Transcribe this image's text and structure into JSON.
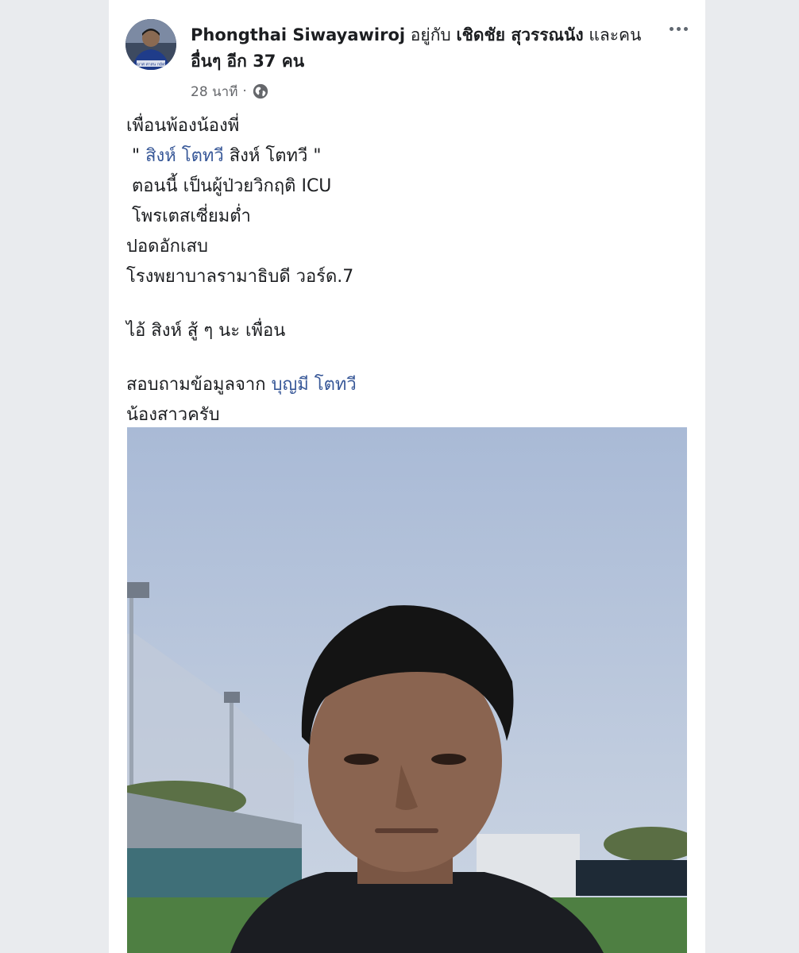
{
  "post": {
    "author": "Phongthai Siwayawiroj",
    "with_text": "อยู่กับ",
    "tagged_friend": "เชิดชัย สุวรรณนัง",
    "and_text": "และคน",
    "others_line": "อื่นๆ อีก 37 คน",
    "time": "28 นาที",
    "dot": "·",
    "privacy_icon": "globe-icon",
    "more_icon": "more-options-icon",
    "avatar_caption": "รักษาศ ศาสน กษัตริย์",
    "body": {
      "line1": "เพื่อนพ้องน้องพี่",
      "line2_open": " \" ",
      "line2_link": "สิงห์ โตทวี",
      "line2_rest": " สิงห์ โตทวี \"",
      "line3": " ตอนนี้ เป็นผู้ป่วยวิกฤติ ICU",
      "line4": " โพรเตสเซี่ยมต่ำ",
      "line5": "ปอดอักเสบ",
      "line6": "โรงพยาบาลรามาธิบดี วอร์ด.7",
      "line7": "ไอ้ สิงห์ สู้ ๆ นะ เพื่อน",
      "line8_text": "สอบถามข้อมูลจาก ",
      "line8_link": "บุญมี โตทวี",
      "line9": "น้องสาวครับ"
    }
  },
  "colors": {
    "link": "#385898",
    "meta": "#65676b",
    "background": "#e9ebee"
  }
}
